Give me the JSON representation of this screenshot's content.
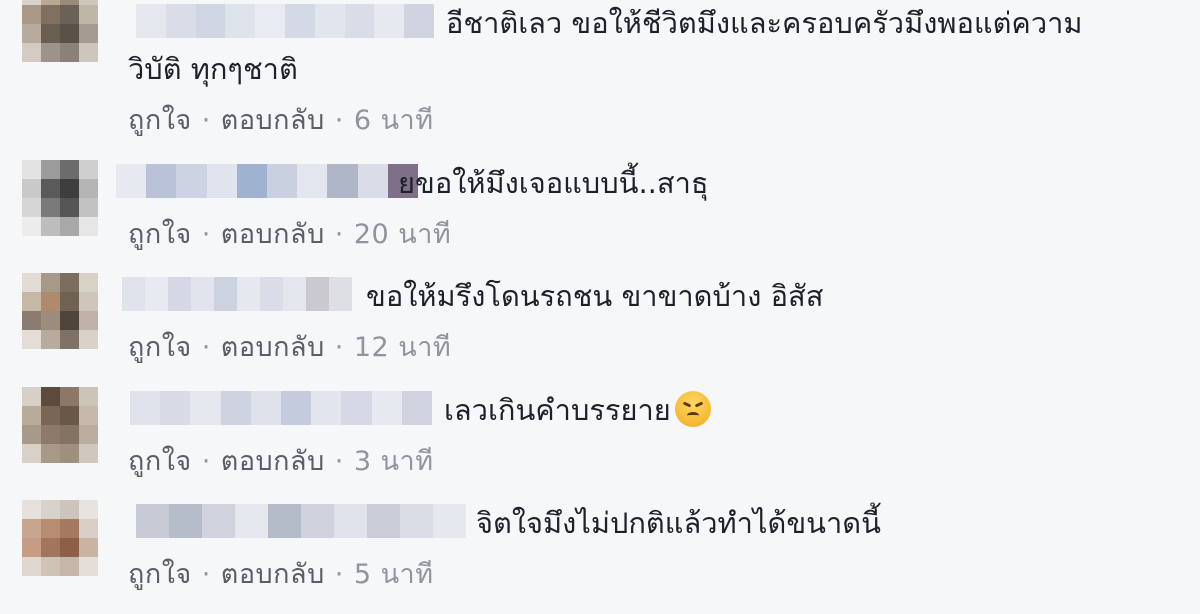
{
  "comments": [
    {
      "text": "อีชาติเลว ขอให้ชีวิตมึงและครอบครัวมึงพอแต่ความวิบัติ ทุกๆชาติ",
      "like": "ถูกใจ",
      "reply": "ตอบกลับ",
      "time": "6 นาที",
      "avatar_colors": [
        "#d9d2c8",
        "#b8a996",
        "#9a8b78",
        "#cfc7bb",
        "#a99885",
        "#7f6f5f",
        "#6c6157",
        "#c0b6a8",
        "#b7ab9d",
        "#6a5e52",
        "#5a5149",
        "#a59b8f",
        "#d3cbc1",
        "#9c948a",
        "#8a8279",
        "#cdc6bd"
      ],
      "name_colors": [
        "#e4e7ee",
        "#d8dde8",
        "#cfd5e3",
        "#dfe3ec",
        "#e8ebf1",
        "#d4d9e6",
        "#e1e5ee",
        "#d9dde7",
        "#e6e9f0",
        "#cfd4e0"
      ]
    },
    {
      "text": "ยขอให้มึงเจอแบบนี้..สาธุ",
      "like": "ถูกใจ",
      "reply": "ตอบกลับ",
      "time": "20 นาที",
      "avatar_colors": [
        "#e3e3e3",
        "#9b9b9b",
        "#6c6c6c",
        "#cfcfcf",
        "#c9c9c9",
        "#5a5a5a",
        "#3e3e3e",
        "#b4b4b4",
        "#d6d6d6",
        "#7a7a7a",
        "#555555",
        "#c2c2c2",
        "#ececec",
        "#bdbdbd",
        "#a8a8a8",
        "#e6e6e6"
      ],
      "name_colors": [
        "#e6e9f0",
        "#b9c2d6",
        "#cdd3e2",
        "#dfe4ee",
        "#9fb2cf",
        "#c9d1e1",
        "#e2e6ee",
        "#aeb6c8",
        "#d8dde8",
        "#7f6f88"
      ]
    },
    {
      "text": "ขอให้มรึงโดนรถชน ขาขาดบ้าง อิสัส",
      "like": "ถูกใจ",
      "reply": "ตอบกลับ",
      "time": "12 นาที",
      "avatar_colors": [
        "#e2dcd4",
        "#a69988",
        "#7b6e5f",
        "#d8d1c6",
        "#c7b8a6",
        "#b08a6d",
        "#6f6153",
        "#cfc5b8",
        "#8a7d6f",
        "#9c8c7b",
        "#4f453b",
        "#bdb2a5",
        "#e3ddd5",
        "#b7ab9e",
        "#7e7266",
        "#d9d2c9"
      ],
      "name_colors": [
        "#dfe3ec",
        "#e7eaf0",
        "#d3d8e4",
        "#e1e4ec",
        "#ccd2df",
        "#e5e8ef",
        "#d8dde7",
        "#e3e6ed",
        "#c9c9cf",
        "#dedfe4"
      ]
    },
    {
      "text": "เลวเกินคำบรรยาย",
      "like": "ถูกใจ",
      "reply": "ตอบกลับ",
      "time": "3 นาที",
      "avatar_colors": [
        "#d7d0c7",
        "#5d4a3c",
        "#8b7868",
        "#cdc4b8",
        "#b9ab9b",
        "#7b6656",
        "#6a5748",
        "#c4b9ab",
        "#a99988",
        "#8d7a69",
        "#857361",
        "#b9ad9f",
        "#d8d1c8",
        "#a79887",
        "#9e8f7f",
        "#d0c8be"
      ],
      "name_colors": [
        "#dfe3ec",
        "#d6dbe6",
        "#e4e7ee",
        "#cdd3e1",
        "#dde1ea",
        "#c3cbdc",
        "#e1e5ed",
        "#d4d9e5",
        "#e6e9f0",
        "#cfd4e0"
      ]
    },
    {
      "text": "จิตใจมึงไม่ปกติแล้วทำได้ขนาดนี้",
      "like": "ถูกใจ",
      "reply": "ตอบกลับ",
      "time": "5 นาที",
      "avatar_colors": [
        "#e5e2de",
        "#d8d2cb",
        "#cdc5bc",
        "#e7e4e0",
        "#c8a58e",
        "#b88c70",
        "#a27a60",
        "#d9cfc6",
        "#c79c84",
        "#a2765d",
        "#8d5e48",
        "#c9b3a3",
        "#e0d8d0",
        "#cfc3b8",
        "#c5b6a9",
        "#e4ded8"
      ],
      "name_colors": [
        "#c6cbd6",
        "#b6bdca",
        "#d0d4de",
        "#e4e7ee",
        "#b3bac8",
        "#cfd3dd",
        "#dfe3eb",
        "#c7ccd7",
        "#d9dde6",
        "#e5e8ef"
      ]
    }
  ]
}
